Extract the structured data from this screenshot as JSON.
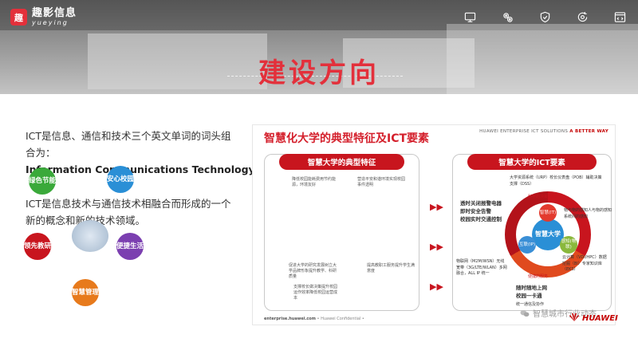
{
  "header": {
    "logo_mark": "趣",
    "logo_cn": "趣影信息",
    "logo_en": "yueying",
    "title": "建设方向",
    "icons": [
      "monitor-icon",
      "gear-cluster-icon",
      "shield-check-icon",
      "refresh-gear-icon",
      "code-window-icon"
    ]
  },
  "content": {
    "para1": "ICT是信息、通信和技术三个英文单词的词头组合为：",
    "para1_en": "Information Communications Technology",
    "para2": "ICT是信息技术与通信技术相融合而形成的一个新的概念和新的技术领域。"
  },
  "figure": {
    "title": "智慧化大学的典型特征及ICT要素",
    "brand_prefix": "HUAWEI ENTERPRISE ICT SOLUTIONS",
    "brand_suffix": "A BETTER WAY",
    "left_panel_title": "智慧大学的典型特征",
    "right_panel_title": "智慧大学的ICT要素",
    "circles": {
      "green": "绿色节能",
      "blue": "安心校园",
      "red": "领先教研",
      "purple": "便捷生活",
      "orange": "智慧管理"
    },
    "left_notes": {
      "green": "降低校园能耗费用节约能源，环境友好",
      "blue": "营造平安和谐环境实现校园事件透明",
      "red": "促进大学的研究发展树立大学品牌形象提升教学、科研质量",
      "purple": "提高教职工服务提升学生满意度",
      "orange": "支撑校长做决策提升校园运作效率降低校园运营成本"
    },
    "core_label": "智慧大学",
    "petals": [
      "智慧(IT)",
      "互联(IP)",
      "感知(物联)"
    ],
    "right_notes": {
      "tl": "大学资源系统（URP）校长仪表盘（POB）辅助决策支撑（DSS）",
      "tl_tag": "科学的决策系统",
      "lb1": "透时关闭报警电器",
      "lb2": "即时安全告警",
      "lb3": "校园实时交通控制",
      "rt": "物与物的感知人与物的感知系统间的感知",
      "rb": "云计算（VDI/HPC）数据挖掘（BI）专家知识库（EKS）",
      "bl": "物联网（M2M/WSN）无线宽带（3G/LTE/WLAN）多网融合，ALL IP 统一",
      "bb1": "随时随地上网",
      "bb2": "校园一卡通",
      "bb3": "统一通信及协作",
      "bb_tag": "便捷的服务"
    },
    "footer_url": "enterprise.huawei.com",
    "footer_note": "• Huawei Confidential •"
  },
  "watermark": {
    "wechat_text": "智慧城市行业动态",
    "huawei": "HUAWEI"
  },
  "colors": {
    "accent": "#e3303b",
    "panel_red": "#c8151e"
  }
}
